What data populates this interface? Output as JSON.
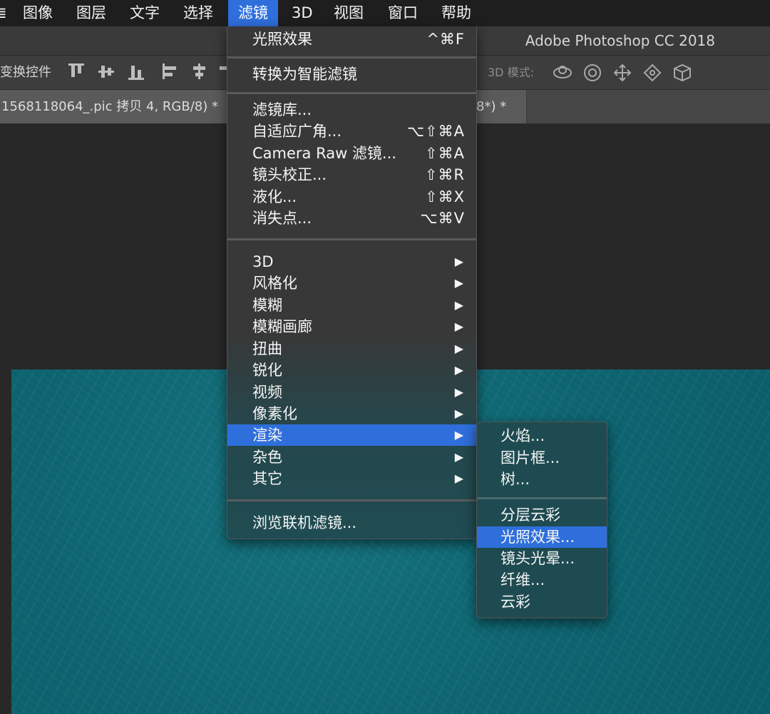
{
  "menubar": {
    "items": [
      {
        "label": "≣"
      },
      {
        "label": "图像"
      },
      {
        "label": "图层"
      },
      {
        "label": "文字"
      },
      {
        "label": "选择"
      },
      {
        "label": "滤镜"
      },
      {
        "label": "3D"
      },
      {
        "label": "视图"
      },
      {
        "label": "窗口"
      },
      {
        "label": "帮助"
      }
    ]
  },
  "window": {
    "title": "Adobe Photoshop CC 2018"
  },
  "options_bar": {
    "transform_label": "变换控件",
    "mode_label": "3D 模式:"
  },
  "tabs": {
    "doc1": "1568118064_.pic 拷贝 4, RGB/8) *",
    "doc2": "8*) *"
  },
  "filter_menu": {
    "top": [
      {
        "label": "光照效果",
        "shortcut": "^⌘F"
      }
    ],
    "smart": [
      {
        "label": "转换为智能滤镜"
      }
    ],
    "tools": [
      {
        "label": "滤镜库..."
      },
      {
        "label": "自适应广角...",
        "shortcut": "⌥⇧⌘A"
      },
      {
        "label": "Camera Raw 滤镜...",
        "shortcut": "⇧⌘A"
      },
      {
        "label": "镜头校正...",
        "shortcut": "⇧⌘R"
      },
      {
        "label": "液化...",
        "shortcut": "⇧⌘X"
      },
      {
        "label": "消失点...",
        "shortcut": "⌥⌘V"
      }
    ],
    "groups": [
      {
        "label": "3D",
        "arrow": "▶"
      },
      {
        "label": "风格化",
        "arrow": "▶"
      },
      {
        "label": "模糊",
        "arrow": "▶"
      },
      {
        "label": "模糊画廊",
        "arrow": "▶"
      },
      {
        "label": "扭曲",
        "arrow": "▶"
      },
      {
        "label": "锐化",
        "arrow": "▶"
      },
      {
        "label": "视频",
        "arrow": "▶"
      },
      {
        "label": "像素化",
        "arrow": "▶"
      },
      {
        "label": "渲染",
        "arrow": "▶"
      },
      {
        "label": "杂色",
        "arrow": "▶"
      },
      {
        "label": "其它",
        "arrow": "▶"
      }
    ],
    "browse": {
      "label": "浏览联机滤镜..."
    }
  },
  "render_submenu": {
    "group1": [
      {
        "label": "火焰..."
      },
      {
        "label": "图片框..."
      },
      {
        "label": "树..."
      }
    ],
    "group2": [
      {
        "label": "分层云彩"
      },
      {
        "label": "光照效果..."
      },
      {
        "label": "镜头光晕..."
      },
      {
        "label": "纤维..."
      },
      {
        "label": "云彩"
      }
    ]
  },
  "colors": {
    "highlight": "#2f6fdc",
    "canvas_teal": "#0e6672"
  }
}
